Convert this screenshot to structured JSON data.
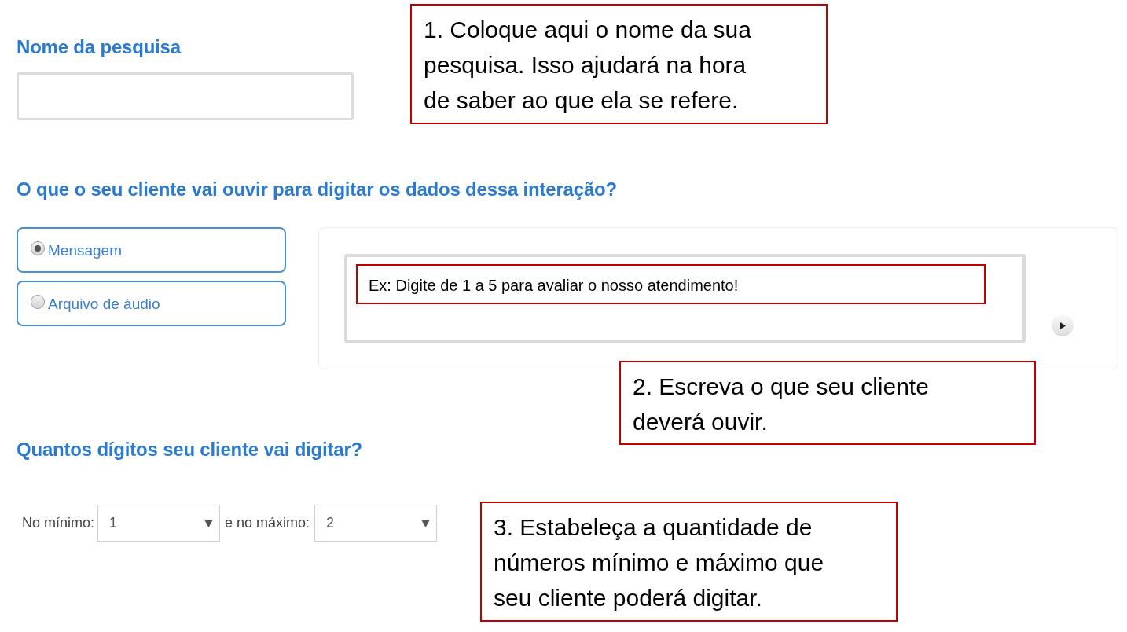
{
  "survey_name": {
    "heading": "Nome da pesquisa"
  },
  "prompt": {
    "heading": "O que o seu cliente vai ouvir para digitar os dados dessa interação?",
    "options": [
      {
        "label": "Mensagem",
        "selected": true
      },
      {
        "label": "Arquivo de áudio",
        "selected": false
      }
    ],
    "message_example": "Ex: Digite de 1 a 5 para avaliar o nosso atendimento!"
  },
  "digits": {
    "heading": "Quantos dígitos seu cliente vai digitar?",
    "min_label": "No mínimo:",
    "min_value": "1",
    "max_label": "e no máximo:",
    "max_value": "2"
  },
  "callouts": [
    {
      "text": "1. Coloque aqui o nome da sua pesquisa. Isso ajudará na hora de saber ao que ela se refere."
    },
    {
      "text": "2. Escreva o que seu cliente deverá ouvir."
    },
    {
      "text": "3. Estabeleça a quantidade de números mínimo e máximo que seu cliente poderá digitar."
    }
  ]
}
